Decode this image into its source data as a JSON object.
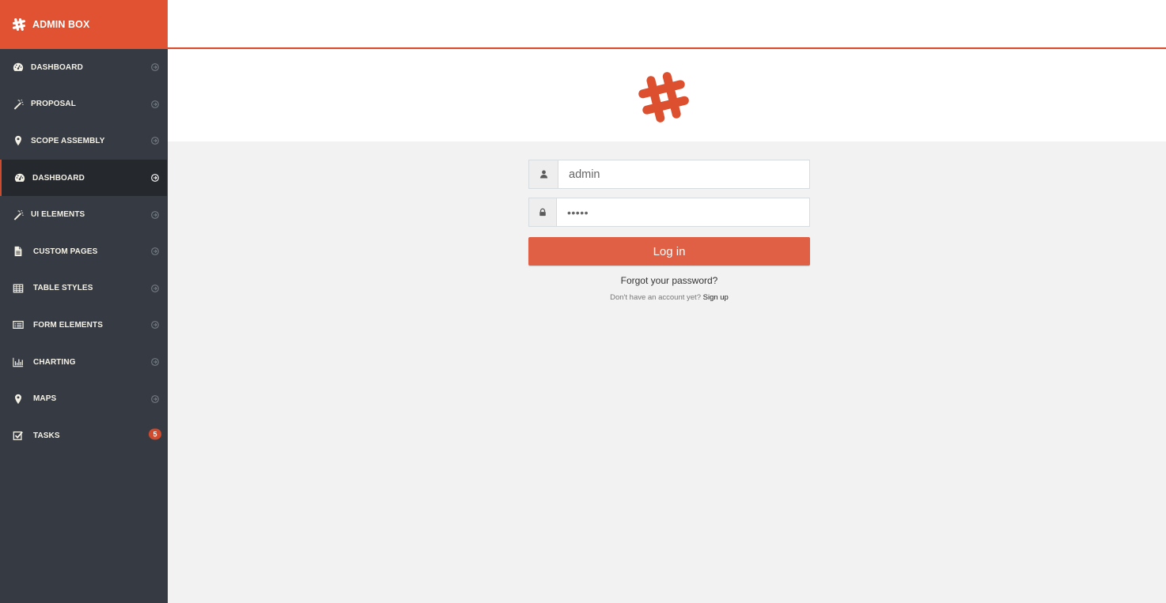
{
  "brand": {
    "title": "ADMIN BOX",
    "icon": "hashtag-icon",
    "color": "#e05231"
  },
  "sidebar": {
    "items": [
      {
        "label": "DASHBOARD",
        "icon": "dashboard-icon",
        "active": false
      },
      {
        "label": "PROPOSAL",
        "icon": "magic-wand-icon",
        "active": false
      },
      {
        "label": "SCOPE ASSEMBLY",
        "icon": "map-marker-icon",
        "active": false
      },
      {
        "label": "DASHBOARD",
        "icon": "dashboard-icon",
        "active": true
      },
      {
        "label": "UI ELEMENTS",
        "icon": "magic-wand-icon",
        "active": false
      },
      {
        "label": "CUSTOM PAGES",
        "icon": "file-icon",
        "active": false
      },
      {
        "label": "TABLE STYLES",
        "icon": "table-icon",
        "active": false
      },
      {
        "label": "FORM ELEMENTS",
        "icon": "list-alt-icon",
        "active": false
      },
      {
        "label": "CHARTING",
        "icon": "bar-chart-icon",
        "active": false
      },
      {
        "label": "MAPS",
        "icon": "map-marker-icon",
        "active": false
      },
      {
        "label": "TASKS",
        "icon": "check-square-icon",
        "active": false,
        "badge": "5"
      }
    ]
  },
  "login": {
    "username_value": "admin",
    "password_value": "•••••",
    "submit_label": "Log in",
    "forgot_label": "Forgot your password?",
    "no_account_text": "Don't have an account yet?",
    "signup_label": "Sign up"
  },
  "colors": {
    "accent": "#e05231",
    "button": "#df6045",
    "sidebar_bg": "#363b43",
    "sidebar_active_bg": "#25282d",
    "content_bg": "#f2f2f2"
  }
}
